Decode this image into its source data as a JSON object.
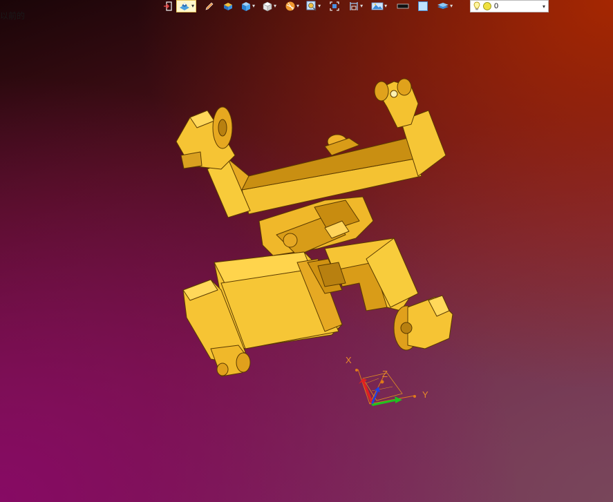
{
  "viewport": {
    "label": "以前的",
    "background_colors": [
      "#1a0508",
      "#aa2800",
      "#870a64",
      "#784658"
    ]
  },
  "toolbar": {
    "items": [
      {
        "name": "exit-sketch",
        "icon": "exit-door-icon"
      },
      {
        "name": "display-mode",
        "icon": "render-mode-icon",
        "active": true,
        "dropdown": true
      },
      {
        "name": "edit-object",
        "icon": "pencil-icon"
      },
      {
        "name": "part",
        "icon": "box-part-icon"
      },
      {
        "name": "shaded-view",
        "icon": "shaded-cube-icon",
        "dropdown": true
      },
      {
        "name": "wireframe-view",
        "icon": "wireframe-cube-icon",
        "dropdown": true
      },
      {
        "name": "section-view",
        "icon": "section-sphere-icon",
        "dropdown": true
      },
      {
        "name": "zoom",
        "icon": "zoom-icon",
        "dropdown": true
      },
      {
        "name": "fit-view",
        "icon": "fit-view-icon"
      },
      {
        "name": "dimension",
        "icon": "dimension-icon",
        "dropdown": true
      },
      {
        "name": "render-settings",
        "icon": "landscape-icon",
        "dropdown": true
      },
      {
        "name": "black-background",
        "icon": "black-rect-icon"
      },
      {
        "name": "light-background",
        "icon": "blue-rect-icon"
      },
      {
        "name": "layers",
        "icon": "layers-icon",
        "dropdown": true
      }
    ]
  },
  "layer_selector": {
    "value": "0",
    "icons": [
      "lightbulb-icon",
      "sun-icon"
    ]
  },
  "model": {
    "color": "#f2bb2c",
    "edge_color": "#5a3a00"
  },
  "triad": {
    "x_label": "X",
    "y_label": "Y",
    "z_label": "Z",
    "x_color": "#e02020",
    "y_color": "#20c020",
    "z_color": "#2040e0"
  }
}
